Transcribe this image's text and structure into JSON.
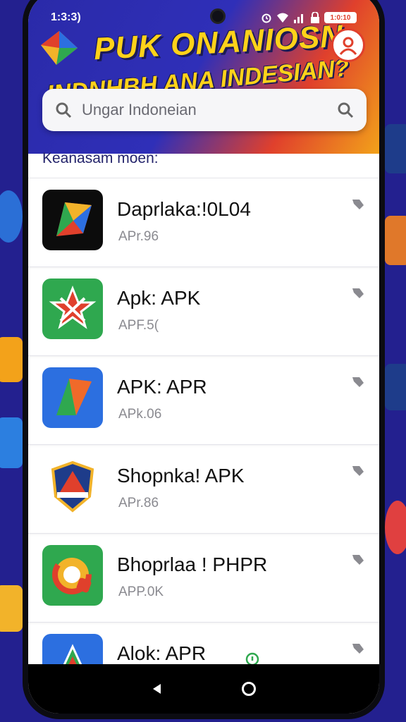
{
  "status": {
    "time": "1:3:3)",
    "battery": "1:0:10"
  },
  "header": {
    "title_line1": "PUK ONANIOSN",
    "title_line2": "INDNHBH ANA INDESIAN?"
  },
  "search": {
    "placeholder": "Ungar Indoneian"
  },
  "section": {
    "label": "Keanasam moen:"
  },
  "apps": [
    {
      "name": "Daprlaka:!0L04",
      "sub": "APr.96",
      "icon": "kite-logo-icon"
    },
    {
      "name": "Apk: APK",
      "sub": "APF.5(",
      "icon": "star-shield-icon"
    },
    {
      "name": "APK: APR",
      "sub": "APk.06",
      "icon": "paper-plane-icon"
    },
    {
      "name": "Shopnka! APK",
      "sub": "APr.86",
      "icon": "crest-badge-icon"
    },
    {
      "name": "Bhoprlaa ! PHPR",
      "sub": "APP.0K",
      "icon": "q-leaf-icon"
    },
    {
      "name": "Alok: APR",
      "sub": "",
      "icon": "a-shield-icon"
    }
  ],
  "colors": {
    "background": "#23208f",
    "title_yellow": "#ffd21a",
    "accent_red": "#e0402c"
  }
}
